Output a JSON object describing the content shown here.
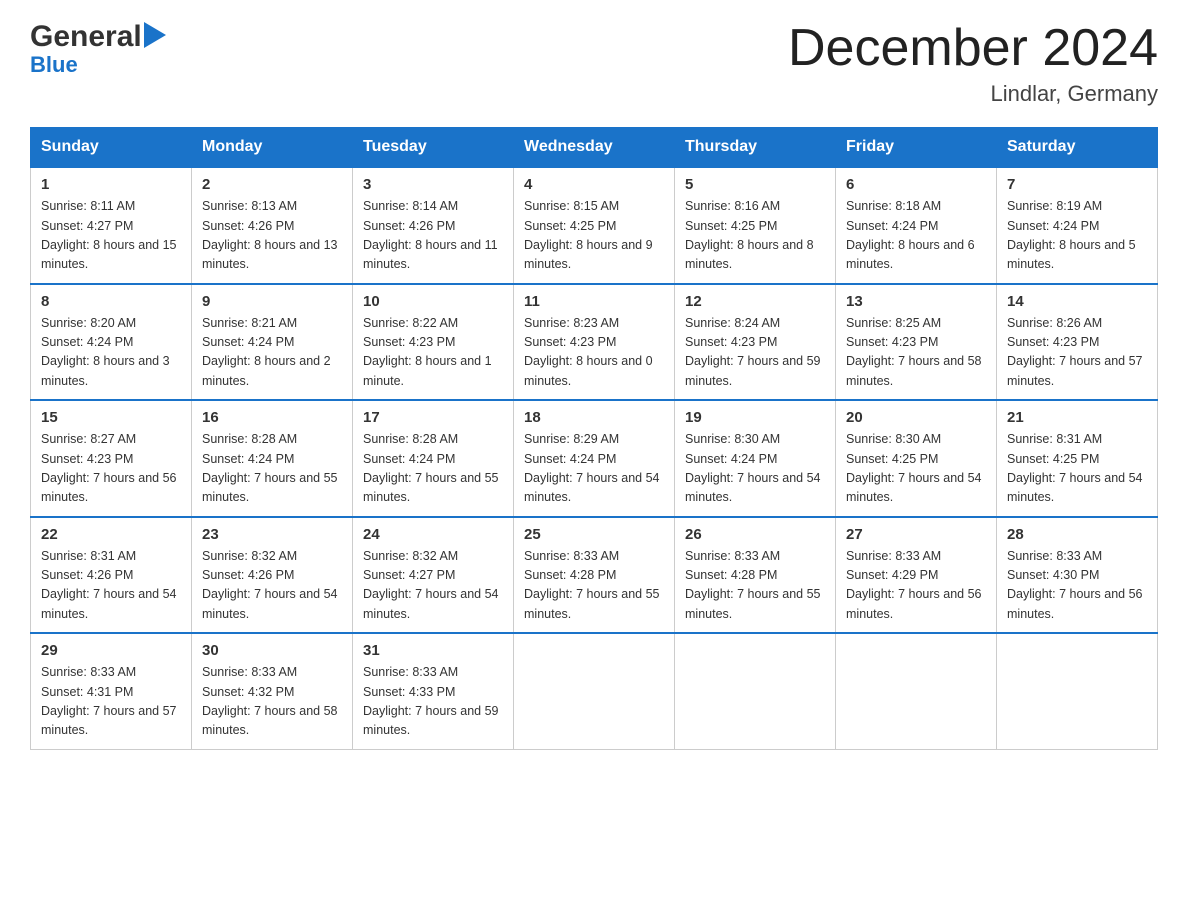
{
  "header": {
    "logo_general": "General",
    "logo_blue": "Blue",
    "title": "December 2024",
    "location": "Lindlar, Germany"
  },
  "days_of_week": [
    "Sunday",
    "Monday",
    "Tuesday",
    "Wednesday",
    "Thursday",
    "Friday",
    "Saturday"
  ],
  "weeks": [
    [
      {
        "day": "1",
        "sunrise": "8:11 AM",
        "sunset": "4:27 PM",
        "daylight": "8 hours and 15 minutes."
      },
      {
        "day": "2",
        "sunrise": "8:13 AM",
        "sunset": "4:26 PM",
        "daylight": "8 hours and 13 minutes."
      },
      {
        "day": "3",
        "sunrise": "8:14 AM",
        "sunset": "4:26 PM",
        "daylight": "8 hours and 11 minutes."
      },
      {
        "day": "4",
        "sunrise": "8:15 AM",
        "sunset": "4:25 PM",
        "daylight": "8 hours and 9 minutes."
      },
      {
        "day": "5",
        "sunrise": "8:16 AM",
        "sunset": "4:25 PM",
        "daylight": "8 hours and 8 minutes."
      },
      {
        "day": "6",
        "sunrise": "8:18 AM",
        "sunset": "4:24 PM",
        "daylight": "8 hours and 6 minutes."
      },
      {
        "day": "7",
        "sunrise": "8:19 AM",
        "sunset": "4:24 PM",
        "daylight": "8 hours and 5 minutes."
      }
    ],
    [
      {
        "day": "8",
        "sunrise": "8:20 AM",
        "sunset": "4:24 PM",
        "daylight": "8 hours and 3 minutes."
      },
      {
        "day": "9",
        "sunrise": "8:21 AM",
        "sunset": "4:24 PM",
        "daylight": "8 hours and 2 minutes."
      },
      {
        "day": "10",
        "sunrise": "8:22 AM",
        "sunset": "4:23 PM",
        "daylight": "8 hours and 1 minute."
      },
      {
        "day": "11",
        "sunrise": "8:23 AM",
        "sunset": "4:23 PM",
        "daylight": "8 hours and 0 minutes."
      },
      {
        "day": "12",
        "sunrise": "8:24 AM",
        "sunset": "4:23 PM",
        "daylight": "7 hours and 59 minutes."
      },
      {
        "day": "13",
        "sunrise": "8:25 AM",
        "sunset": "4:23 PM",
        "daylight": "7 hours and 58 minutes."
      },
      {
        "day": "14",
        "sunrise": "8:26 AM",
        "sunset": "4:23 PM",
        "daylight": "7 hours and 57 minutes."
      }
    ],
    [
      {
        "day": "15",
        "sunrise": "8:27 AM",
        "sunset": "4:23 PM",
        "daylight": "7 hours and 56 minutes."
      },
      {
        "day": "16",
        "sunrise": "8:28 AM",
        "sunset": "4:24 PM",
        "daylight": "7 hours and 55 minutes."
      },
      {
        "day": "17",
        "sunrise": "8:28 AM",
        "sunset": "4:24 PM",
        "daylight": "7 hours and 55 minutes."
      },
      {
        "day": "18",
        "sunrise": "8:29 AM",
        "sunset": "4:24 PM",
        "daylight": "7 hours and 54 minutes."
      },
      {
        "day": "19",
        "sunrise": "8:30 AM",
        "sunset": "4:24 PM",
        "daylight": "7 hours and 54 minutes."
      },
      {
        "day": "20",
        "sunrise": "8:30 AM",
        "sunset": "4:25 PM",
        "daylight": "7 hours and 54 minutes."
      },
      {
        "day": "21",
        "sunrise": "8:31 AM",
        "sunset": "4:25 PM",
        "daylight": "7 hours and 54 minutes."
      }
    ],
    [
      {
        "day": "22",
        "sunrise": "8:31 AM",
        "sunset": "4:26 PM",
        "daylight": "7 hours and 54 minutes."
      },
      {
        "day": "23",
        "sunrise": "8:32 AM",
        "sunset": "4:26 PM",
        "daylight": "7 hours and 54 minutes."
      },
      {
        "day": "24",
        "sunrise": "8:32 AM",
        "sunset": "4:27 PM",
        "daylight": "7 hours and 54 minutes."
      },
      {
        "day": "25",
        "sunrise": "8:33 AM",
        "sunset": "4:28 PM",
        "daylight": "7 hours and 55 minutes."
      },
      {
        "day": "26",
        "sunrise": "8:33 AM",
        "sunset": "4:28 PM",
        "daylight": "7 hours and 55 minutes."
      },
      {
        "day": "27",
        "sunrise": "8:33 AM",
        "sunset": "4:29 PM",
        "daylight": "7 hours and 56 minutes."
      },
      {
        "day": "28",
        "sunrise": "8:33 AM",
        "sunset": "4:30 PM",
        "daylight": "7 hours and 56 minutes."
      }
    ],
    [
      {
        "day": "29",
        "sunrise": "8:33 AM",
        "sunset": "4:31 PM",
        "daylight": "7 hours and 57 minutes."
      },
      {
        "day": "30",
        "sunrise": "8:33 AM",
        "sunset": "4:32 PM",
        "daylight": "7 hours and 58 minutes."
      },
      {
        "day": "31",
        "sunrise": "8:33 AM",
        "sunset": "4:33 PM",
        "daylight": "7 hours and 59 minutes."
      },
      null,
      null,
      null,
      null
    ]
  ]
}
